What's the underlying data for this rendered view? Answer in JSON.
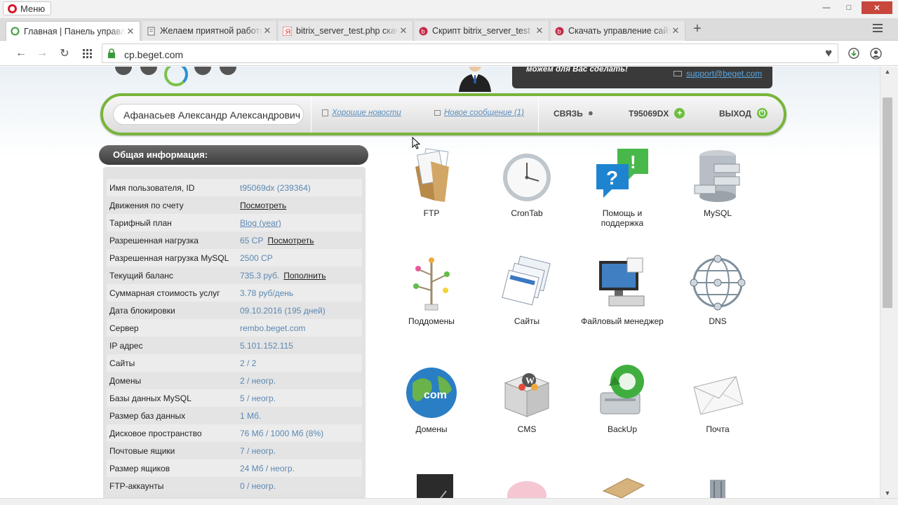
{
  "browser": {
    "menu_label": "Меню",
    "tabs": [
      {
        "title": "Главная | Панель управления",
        "active": true
      },
      {
        "title": "Желаем приятной работы",
        "active": false
      },
      {
        "title": "bitrix_server_test.php скачать",
        "active": false
      },
      {
        "title": "Скрипт bitrix_server_test",
        "active": false
      },
      {
        "title": "Скачать управление сайтом",
        "active": false
      }
    ],
    "new_tab": "+",
    "url": "cp.beget.com"
  },
  "header": {
    "support_text": "можем для Вас сделать!",
    "support_email": "support@beget.com"
  },
  "userbar": {
    "user_name": "Афанасьев Александр Александрович",
    "news_link": "Хорошие новости",
    "message_link": "Новое сообщение (1)",
    "contact_label": "СВЯЗЬ",
    "account_label": "T95069DX",
    "logout_label": "ВЫХОД"
  },
  "info": {
    "title": "Общая информация:",
    "rows": [
      {
        "label": "Имя пользователя, ID",
        "value": "t95069dx (239364)",
        "action": ""
      },
      {
        "label": "Движения по счету",
        "value": "",
        "action": "Посмотреть"
      },
      {
        "label": "Тарифный план",
        "value": "Blog (year)",
        "action": ""
      },
      {
        "label": "Разрешенная нагрузка",
        "value": "65 CP",
        "action": "Посмотреть"
      },
      {
        "label": "Разрешенная нагрузка MySQL",
        "value": "2500 CP",
        "action": ""
      },
      {
        "label": "Текущий баланс",
        "value": "735.3 руб.",
        "action": "Пополнить"
      },
      {
        "label": "Суммарная стоимость услуг",
        "value": "3.78 руб/день",
        "action": ""
      },
      {
        "label": "Дата блокировки",
        "value": "09.10.2016 (195 дней)",
        "action": ""
      },
      {
        "label": "Сервер",
        "value": "rembo.beget.com",
        "action": ""
      },
      {
        "label": "IP адрес",
        "value": "5.101.152.115",
        "action": ""
      },
      {
        "label": "Сайты",
        "value": "2 / 2",
        "action": ""
      },
      {
        "label": "Домены",
        "value": "2 / неогр.",
        "action": ""
      },
      {
        "label": "Базы данных MySQL",
        "value": "5 / неогр.",
        "action": ""
      },
      {
        "label": "Размер баз данных",
        "value": "1 Мб.",
        "action": ""
      },
      {
        "label": "Дисковое пространство",
        "value": "76 Мб / 1000 Мб (8%)",
        "action": ""
      },
      {
        "label": "Почтовые ящики",
        "value": "7 / неогр.",
        "action": ""
      },
      {
        "label": "Размер ящиков",
        "value": "24 Мб / неогр.",
        "action": ""
      },
      {
        "label": "FTP-аккаунты",
        "value": "0 / неогр.",
        "action": ""
      }
    ]
  },
  "tiles": [
    {
      "label": "FTP",
      "icon": "ftp-folder-icon"
    },
    {
      "label": "CronTab",
      "icon": "clock-icon"
    },
    {
      "label": "Помощь и поддержка",
      "icon": "help-bubble-icon"
    },
    {
      "label": "MySQL",
      "icon": "database-cabinet-icon"
    },
    {
      "label": "Поддомены",
      "icon": "tree-icon"
    },
    {
      "label": "Сайты",
      "icon": "websites-stack-icon"
    },
    {
      "label": "Файловый менеджер",
      "icon": "computer-icon"
    },
    {
      "label": "DNS",
      "icon": "globe-network-icon"
    },
    {
      "label": "Домены",
      "icon": "com-globe-icon"
    },
    {
      "label": "CMS",
      "icon": "cms-box-icon"
    },
    {
      "label": "BackUp",
      "icon": "backup-drive-icon"
    },
    {
      "label": "Почта",
      "icon": "envelope-icon"
    }
  ],
  "colors": {
    "accent_green": "#78b43a",
    "link_blue": "#5b87b3",
    "dark_header": "#3d3d3d"
  }
}
